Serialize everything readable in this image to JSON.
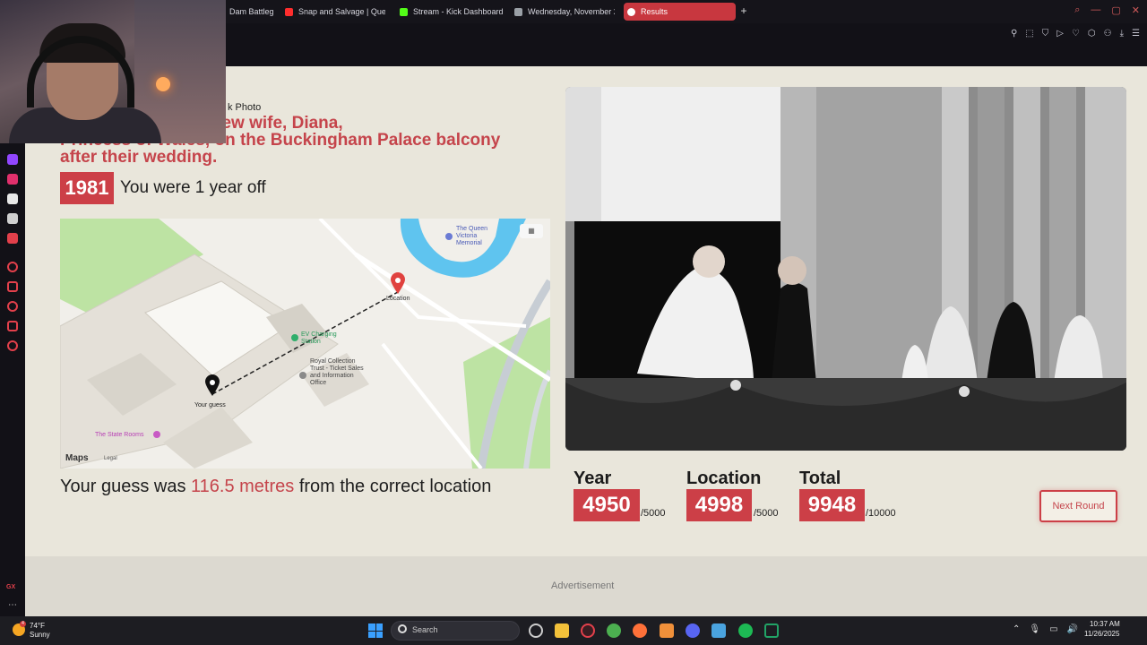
{
  "browser": {
    "tabs": [
      {
        "label": "Dam Battleg",
        "color": "#c0392b"
      },
      {
        "label": "Snap and Salvage | Ques",
        "color": "#ff2d2d"
      },
      {
        "label": "Stream - Kick Dashboard",
        "color": "#53fc18"
      },
      {
        "label": "Wednesday, November 2",
        "color": "#9aa0a6"
      },
      {
        "label": "Results",
        "color": "#ffffff"
      }
    ],
    "new_tab": "+",
    "window_controls": [
      "⌕",
      "—",
      "▢",
      "✕"
    ]
  },
  "page": {
    "source": "k Photo",
    "caption_lines": [
      "ng the hand of his new wife, Diana,",
      "Princess of Wales, on the Buckingham Palace balcony",
      "after their wedding."
    ],
    "year": "1981",
    "year_result": "You were 1 year off",
    "map": {
      "labels": {
        "queen_victoria": "The Queen Victoria Memorial",
        "location": "Location",
        "ev_charging": "EV Charging Station",
        "royal_collection": "Royal Collection Trust - Ticket Sales and Information Office",
        "your_guess": "Your guess",
        "state_rooms": "The State Rooms"
      },
      "logo": "Maps",
      "legal": "Legal"
    },
    "distance": {
      "prefix": "Your guess was ",
      "value": "116.5 metres",
      "suffix": " from the correct location"
    },
    "scores": {
      "year": {
        "label": "Year",
        "value": "4950",
        "max": "/5000"
      },
      "location": {
        "label": "Location",
        "value": "4998",
        "max": "/5000"
      },
      "total": {
        "label": "Total",
        "value": "9948",
        "max": "/10000"
      }
    },
    "next_button": "Next Round",
    "advertisement": "Advertisement"
  },
  "taskbar": {
    "temp": "74°F",
    "weather": "Sunny",
    "weather_badge": "4",
    "search_placeholder": "Search",
    "time": "10:37 AM",
    "date": "11/26/2025"
  },
  "colors": {
    "accent": "#cc3f47",
    "page_bg": "#e9e6db"
  }
}
